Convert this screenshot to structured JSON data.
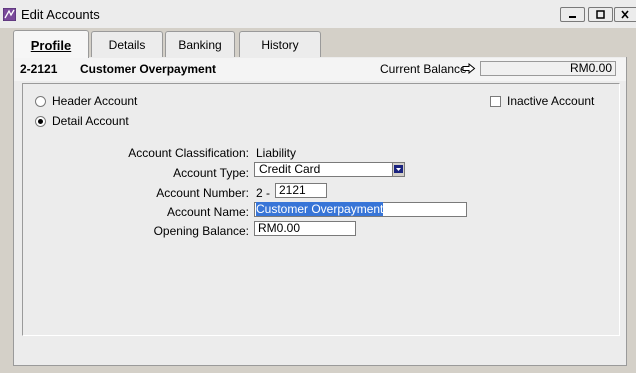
{
  "window": {
    "title": "Edit Accounts"
  },
  "tabs": [
    "Profile",
    "Details",
    "Banking",
    "History"
  ],
  "header": {
    "account_id": "2-2121",
    "account_name": "Customer Overpayment",
    "current_balance_label": "Current Balance",
    "current_balance_value": "RM0.00"
  },
  "options": {
    "header_account": "Header Account",
    "detail_account": "Detail Account",
    "inactive_account": "Inactive Account",
    "selected": "detail_account",
    "inactive_checked": false
  },
  "form": {
    "classification_label": "Account Classification:",
    "classification_value": "Liability",
    "type_label": "Account Type:",
    "type_value": "Credit Card",
    "number_label": "Account Number:",
    "number_prefix": "2 -",
    "number_value": "2121",
    "name_label": "Account Name:",
    "name_value": "Customer Overpayment",
    "opening_label": "Opening Balance:",
    "opening_value": "RM0.00"
  },
  "colors": {
    "selection": "#3875d7",
    "chrome": "#d4d0c8",
    "panel": "#ececec"
  }
}
